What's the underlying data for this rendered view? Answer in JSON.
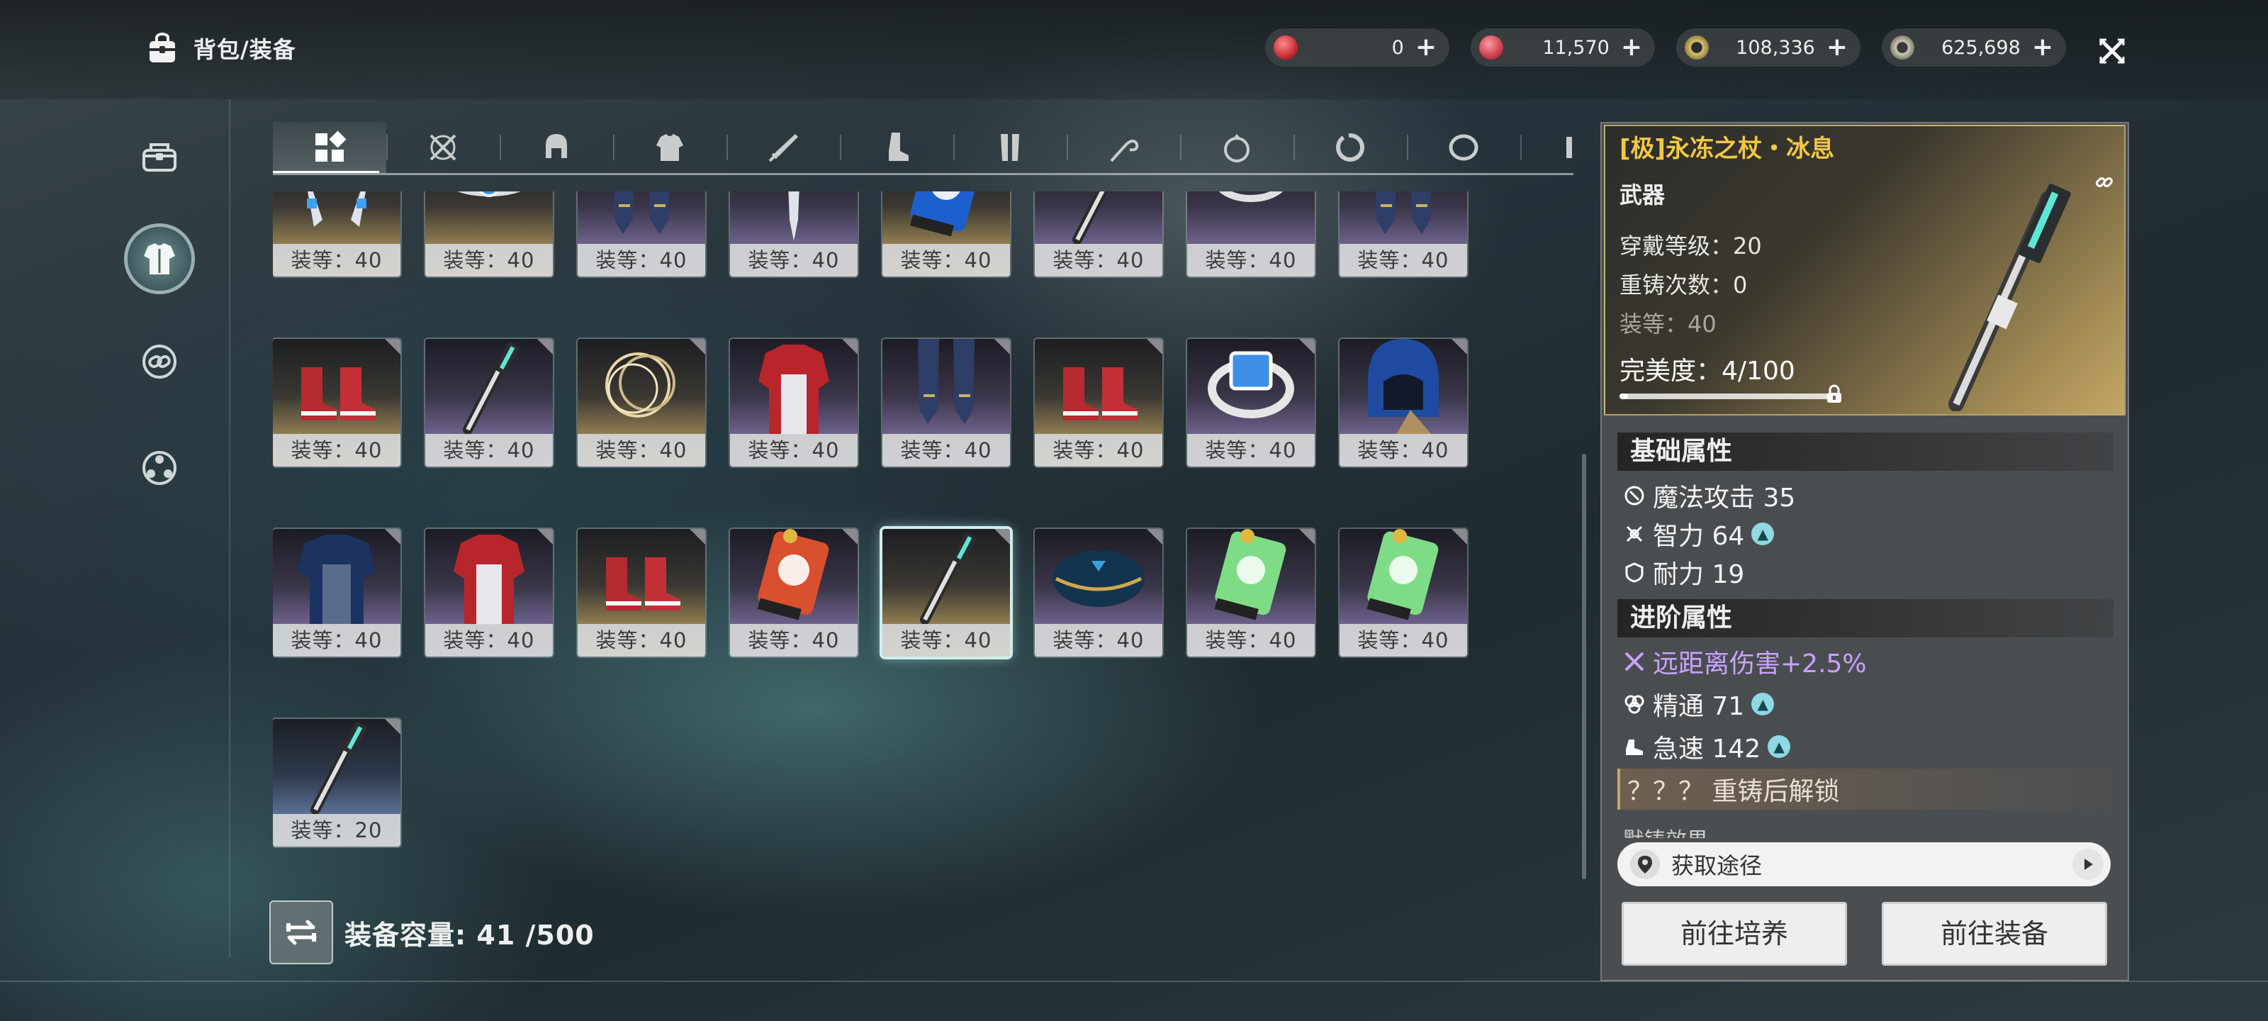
{
  "header": {
    "title": "背包/装备"
  },
  "currencies": [
    {
      "name": "ruby-currency",
      "value": "0",
      "color": "#d8343c"
    },
    {
      "name": "red-gem-currency",
      "value": "11,570",
      "color": "#e04050"
    },
    {
      "name": "gold-coin-currency",
      "value": "108,336",
      "color": "#d8c070"
    },
    {
      "name": "silver-coin-currency",
      "value": "625,698",
      "color": "#c8c4b0"
    }
  ],
  "sidebar": {
    "items": [
      "backpack",
      "equipment",
      "material",
      "social"
    ],
    "active": "equipment"
  },
  "tabs": [
    "all",
    "weapon-cross",
    "helmet",
    "armor",
    "sword",
    "boots",
    "legs",
    "whip",
    "ring-gem",
    "bracelet",
    "ring",
    "more"
  ],
  "grid": {
    "rows": [
      [
        {
          "icon": "twin-blades",
          "rarity": "gold",
          "label": "装等：40"
        },
        {
          "icon": "bracelet-blue",
          "rarity": "gold",
          "label": "装等：40"
        },
        {
          "icon": "leg-armor",
          "rarity": "purple",
          "label": "装等：40"
        },
        {
          "icon": "blade",
          "rarity": "purple",
          "label": "装等：40"
        },
        {
          "icon": "scroll-blue",
          "rarity": "gold",
          "label": "装等：40"
        },
        {
          "icon": "staff",
          "rarity": "purple",
          "label": "装等：40"
        },
        {
          "icon": "ring-green",
          "rarity": "purple",
          "label": "装等：40"
        },
        {
          "icon": "leg-armor",
          "rarity": "purple",
          "label": "装等：40"
        }
      ],
      [
        {
          "icon": "boots-red",
          "rarity": "gold",
          "label": "装等：40"
        },
        {
          "icon": "staff",
          "rarity": "purple",
          "label": "装等：40"
        },
        {
          "icon": "golden-rings",
          "rarity": "gold",
          "label": "装等：40"
        },
        {
          "icon": "red-armor",
          "rarity": "purple",
          "label": "装等：40"
        },
        {
          "icon": "leg-armor",
          "rarity": "purple",
          "label": "装等：40"
        },
        {
          "icon": "boots-red",
          "rarity": "gold",
          "label": "装等：40"
        },
        {
          "icon": "ring-blue",
          "rarity": "purple",
          "label": "装等：40"
        },
        {
          "icon": "hood-blue",
          "rarity": "purple",
          "label": "装等：40"
        }
      ],
      [
        {
          "icon": "blue-armor",
          "rarity": "purple",
          "label": "装等：40"
        },
        {
          "icon": "red-armor",
          "rarity": "purple",
          "label": "装等：40"
        },
        {
          "icon": "boots-red",
          "rarity": "gold",
          "label": "装等：40"
        },
        {
          "icon": "scroll-red",
          "rarity": "purple",
          "label": "装等：40"
        },
        {
          "icon": "staff",
          "rarity": "gold",
          "label": "装等：40",
          "selected": true
        },
        {
          "icon": "helmet-blue",
          "rarity": "purple",
          "label": "装等：40"
        },
        {
          "icon": "scroll-green",
          "rarity": "purple",
          "label": "装等：40"
        },
        {
          "icon": "scroll-green",
          "rarity": "purple",
          "label": "装等：40"
        }
      ],
      [
        {
          "icon": "staff",
          "rarity": "blue",
          "label": "装等：20"
        }
      ]
    ]
  },
  "capacity": {
    "label": "装备容量: 41 /500"
  },
  "detail": {
    "name": "[极]永冻之杖・冰息",
    "type": "武器",
    "wear_level": "穿戴等级：20",
    "reforge": "重铸次数：0",
    "gear_level": "装等：40",
    "perfection": "完美度：4/100",
    "perfection_value": 0.04,
    "base_title": "基础属性",
    "base_attrs": [
      {
        "icon": "magic-attack-icon",
        "text": "魔法攻击 35",
        "boost": false
      },
      {
        "icon": "intellect-icon",
        "text": "智力 64",
        "boost": true
      },
      {
        "icon": "stamina-icon",
        "text": "耐力 19",
        "boost": false
      }
    ],
    "adv_title": "进阶属性",
    "adv_attrs": [
      {
        "icon": "ranged-damage-icon",
        "text": "远距离伤害+2.5%",
        "boost": false,
        "style": "purple"
      },
      {
        "icon": "mastery-icon",
        "text": "精通 71",
        "boost": true
      },
      {
        "icon": "haste-icon",
        "text": "急速 142",
        "boost": true
      }
    ],
    "locked_attr": "？？？ 重铸后解锁",
    "cut_text": "默铸效果",
    "source_label": "获取途径",
    "btn_cultivate": "前往培养",
    "btn_equip": "前往装备"
  }
}
